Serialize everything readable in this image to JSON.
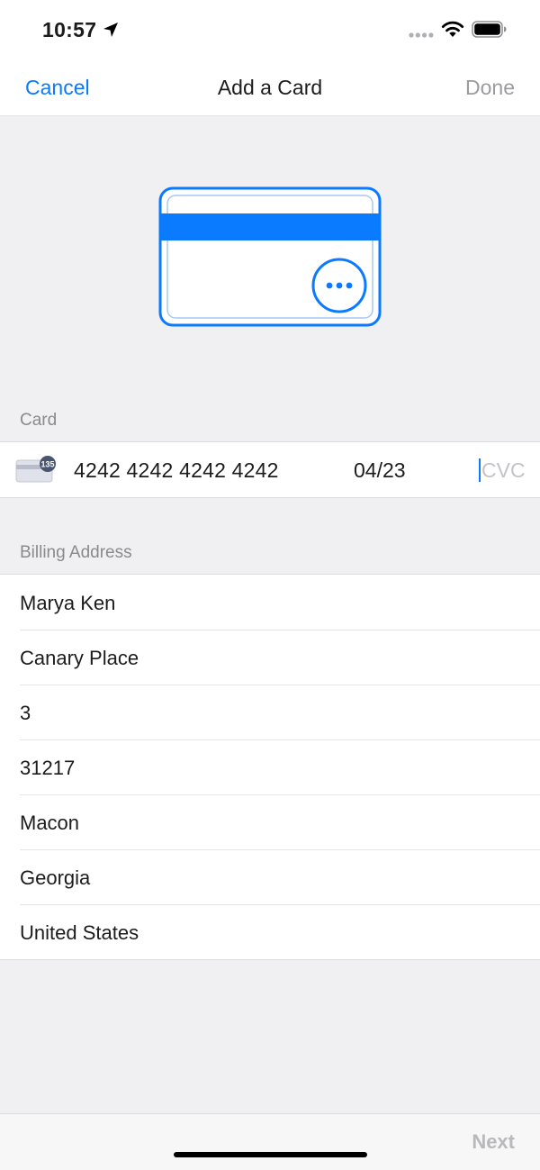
{
  "status_bar": {
    "time": "10:57"
  },
  "nav": {
    "cancel_label": "Cancel",
    "title": "Add a Card",
    "done_label": "Done"
  },
  "card_section": {
    "header": "Card",
    "number": "4242 4242 4242 4242",
    "expiry": "04/23",
    "cvc_placeholder": "CVC",
    "brand_badge": "135"
  },
  "billing_section": {
    "header": "Billing Address",
    "fields": [
      {
        "value": "Marya Ken"
      },
      {
        "value": "Canary Place"
      },
      {
        "value": "3"
      },
      {
        "value": "31217"
      },
      {
        "value": "Macon"
      },
      {
        "value": "Georgia"
      },
      {
        "value": "United States"
      }
    ]
  },
  "bottom": {
    "next_label": "Next"
  },
  "colors": {
    "accent": "#0a7aff",
    "disabled": "#9b9ba0",
    "background": "#f0f0f3"
  }
}
